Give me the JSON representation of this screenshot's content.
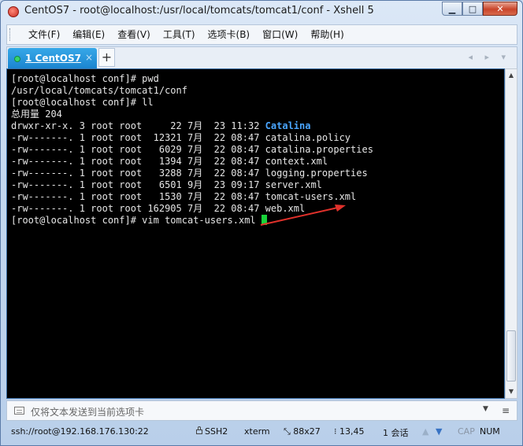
{
  "window": {
    "title": "CentOS7 - root@localhost:/usr/local/tomcats/tomcat1/conf - Xshell 5",
    "controls": {
      "minimize": "▁",
      "maximize": "□",
      "close": "✕"
    }
  },
  "menu": [
    "文件(F)",
    "编辑(E)",
    "查看(V)",
    "工具(T)",
    "选项卡(B)",
    "窗口(W)",
    "帮助(H)"
  ],
  "tabs": {
    "active_label": "1 CentOS7",
    "close": "×",
    "add": "+",
    "nav": "◂ ▸ ▾"
  },
  "terminal": {
    "lines": [
      "[root@localhost conf]# pwd",
      "/usr/local/tomcats/tomcat1/conf",
      "[root@localhost conf]# ll",
      "总用量 204",
      "drwxr-xr-x. 3 root root     22 7月  23 11:32 ",
      "-rw-------. 1 root root  12321 7月  22 08:47 catalina.policy",
      "-rw-------. 1 root root   6029 7月  22 08:47 catalina.properties",
      "-rw-------. 1 root root   1394 7月  22 08:47 context.xml",
      "-rw-------. 1 root root   3288 7月  22 08:47 logging.properties",
      "-rw-------. 1 root root   6501 9月  23 09:17 server.xml",
      "-rw-------. 1 root root   1530 7月  22 08:47 tomcat-users.xml",
      "-rw-------. 1 root root 162905 7月  22 08:47 web.xml",
      "[root@localhost conf]# vim tomcat-users.xml "
    ],
    "highlight": "Catalina",
    "cursor_color": "#19d33a",
    "arrow_color": "#e0312b"
  },
  "compose": {
    "placeholder": "仅将文本发送到当前选项卡",
    "dropdown": "▼",
    "menu": "≡"
  },
  "status": {
    "connection": "ssh://root@192.168.176.130:22",
    "protocol": "SSH2",
    "term": "xterm",
    "size": "88x27",
    "position": "13,45",
    "sessions": "1 会话",
    "up": "▲",
    "down": "▼",
    "cap": "CAP",
    "num": "NUM"
  }
}
